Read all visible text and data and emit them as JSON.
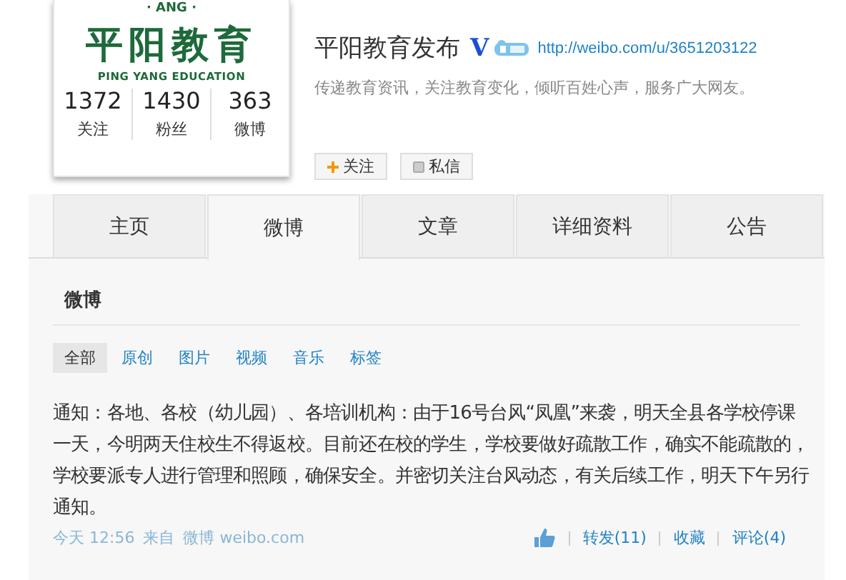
{
  "profile": {
    "logo": {
      "top_text": "· ANG ·",
      "name": "平阳教育",
      "subtitle": "PING YANG EDUCATION"
    },
    "stats": [
      {
        "value": "1372",
        "label": "关注"
      },
      {
        "value": "1430",
        "label": "粉丝"
      },
      {
        "value": "363",
        "label": "微博"
      }
    ],
    "name": "平阳教育发布",
    "verified_mark": "V",
    "url": "http://weibo.com/u/3651203122",
    "bio": "传递教育资讯，关注教育变化，倾听百姓心声，服务广大网友。",
    "actions": [
      {
        "label": "关注",
        "kind": "follow"
      },
      {
        "label": "私信",
        "kind": "message"
      }
    ]
  },
  "tabs": [
    {
      "label": "主页",
      "selected": false
    },
    {
      "label": "微博",
      "selected": true
    },
    {
      "label": "文章",
      "selected": false
    },
    {
      "label": "详细资料",
      "selected": false
    },
    {
      "label": "公告",
      "selected": false
    }
  ],
  "feed": {
    "title": "微博",
    "filters": [
      {
        "label": "全部",
        "selected": true
      },
      {
        "label": "原创",
        "selected": false
      },
      {
        "label": "图片",
        "selected": false
      },
      {
        "label": "视频",
        "selected": false
      },
      {
        "label": "音乐",
        "selected": false
      },
      {
        "label": "标签",
        "selected": false
      }
    ],
    "posts": [
      {
        "text": "通知：各地、各校（幼儿园）、各培训机构：由于16号台风“凤凰”来袭，明天全县各学校停课一天，今明两天住校生不得返校。目前还在校的学生，学校要做好疏散工作，确实不能疏散的，学校要派专人进行管理和照顾，确保安全。并密切关注台风动态，有关后续工作，明天下午另行通知。",
        "time": "今天 12:56",
        "source_prefix": "来自",
        "source": "微博 weibo.com",
        "actions": [
          "转发(11)",
          "收藏",
          "评论(4)"
        ]
      }
    ]
  }
}
